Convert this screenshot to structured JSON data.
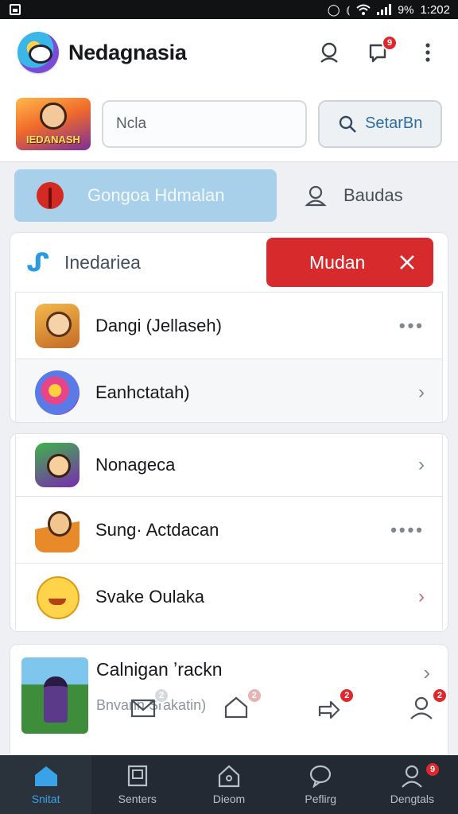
{
  "status_bar": {
    "time": "1:202",
    "battery_label": "9%"
  },
  "app": {
    "title": "Nedagnasia"
  },
  "header": {
    "notification_count": "9"
  },
  "search": {
    "thumb_caption": "IEDANASH",
    "input_value": "Ncla",
    "button_label": "SetarBn"
  },
  "tabs": [
    {
      "label": "Gongoa Hdmalan",
      "active": true
    },
    {
      "label": "Baudas",
      "active": false
    }
  ],
  "card1": {
    "title": "Inedariea",
    "action_label": "Mudan",
    "rows": [
      {
        "label": "Dangi (Jellaseh)",
        "trailing": "dots"
      },
      {
        "label": "Eanhctatah)",
        "trailing": "chevron"
      }
    ]
  },
  "card2": {
    "rows": [
      {
        "label": "Nonageca",
        "trailing": "chevron"
      },
      {
        "label": "Sung· Actdacan",
        "trailing": "dots"
      },
      {
        "label": "Svake Oulaka",
        "trailing": "chevron"
      }
    ]
  },
  "card3": {
    "title": "Calnigan ʼrackn",
    "subtitle": "Bnvann Srakatin)",
    "mini_badges": [
      "2",
      "2",
      "2",
      "2"
    ]
  },
  "bottom_nav": [
    {
      "label": "Snitat",
      "icon": "home-icon",
      "active": true
    },
    {
      "label": "Senters",
      "icon": "device-icon",
      "active": false
    },
    {
      "label": "Dieom",
      "icon": "house-outline-icon",
      "active": false
    },
    {
      "label": "Peflirg",
      "icon": "chat-icon",
      "active": false
    },
    {
      "label": "Dengtals",
      "icon": "profile-icon",
      "active": false,
      "badge": "9"
    }
  ],
  "colors": {
    "accent_blue": "#3aa3e8",
    "danger_red": "#d62a2c",
    "tab_active_bg": "#a9d0ea",
    "nav_bg": "#232a33"
  }
}
